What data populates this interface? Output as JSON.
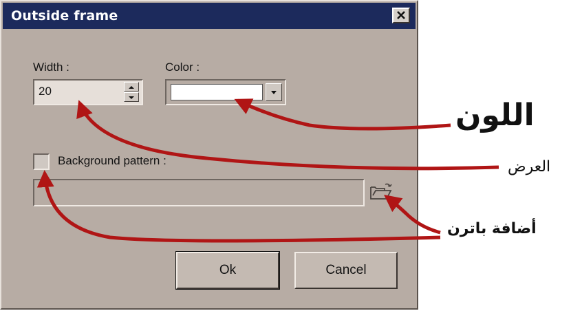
{
  "window": {
    "title": "Outside frame",
    "close_label": "×"
  },
  "width_field": {
    "label": "Width :",
    "value": "20"
  },
  "color_field": {
    "label": "Color :",
    "selected_color": "#ffffff"
  },
  "background_pattern": {
    "label": "Background pattern :",
    "checked": false,
    "value": ""
  },
  "buttons": {
    "ok": "Ok",
    "cancel": "Cancel"
  },
  "annotations": {
    "color": "اللون",
    "width": "العرض",
    "pattern": "أضافة باترن",
    "arrow_color": "#b01515"
  },
  "icons": {
    "close": "close-icon",
    "spin_up": "arrow-up-icon",
    "spin_down": "arrow-down-icon",
    "dropdown": "chevron-down-icon",
    "browse": "folder-open-icon"
  }
}
